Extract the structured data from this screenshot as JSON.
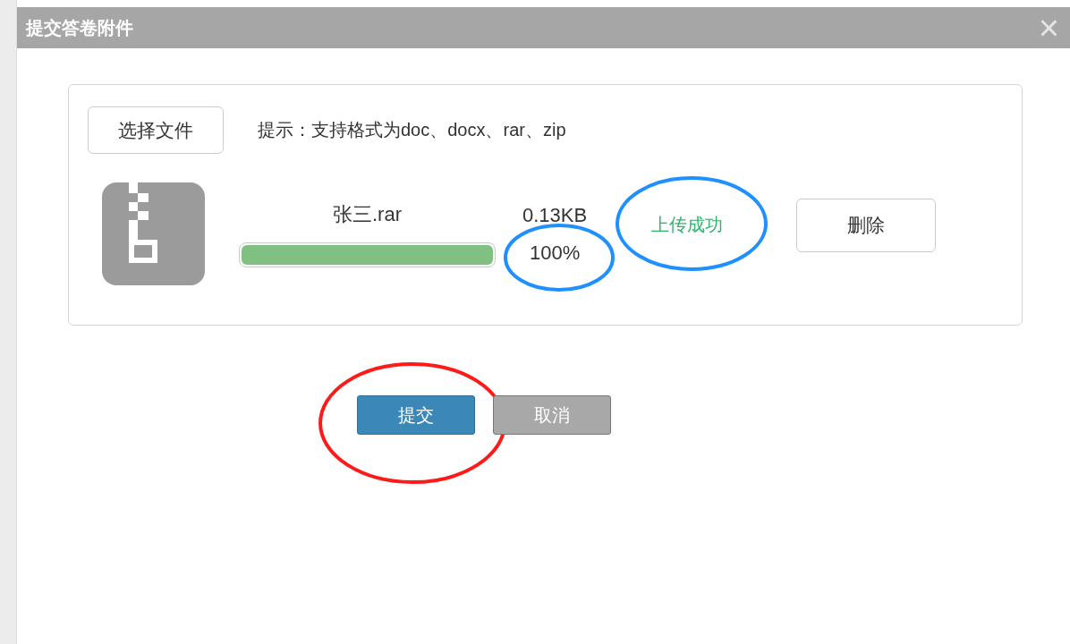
{
  "dialog": {
    "title": "提交答卷附件",
    "close": "×"
  },
  "upload": {
    "choose_button": "选择文件",
    "hint": "提示：支持格式为doc、docx、rar、zip",
    "file": {
      "name": "张三.rar",
      "size": "0.13KB",
      "level": 1,
      "percent": "100%",
      "percent_highlight": {
        "kind": "ellipse",
        "color": "#1e90ff"
      },
      "status": "上传成功",
      "status_highlight": {
        "kind": "ellipse",
        "color": "#1e90ff"
      },
      "delete_button": "删除"
    }
  },
  "actions": [
    {
      "kind": "primary",
      "label": "提交",
      "highlight": {
        "kind": "ellipse",
        "color": "#ff1a1a"
      }
    },
    {
      "kind": "secondary",
      "label": "取消"
    }
  ]
}
